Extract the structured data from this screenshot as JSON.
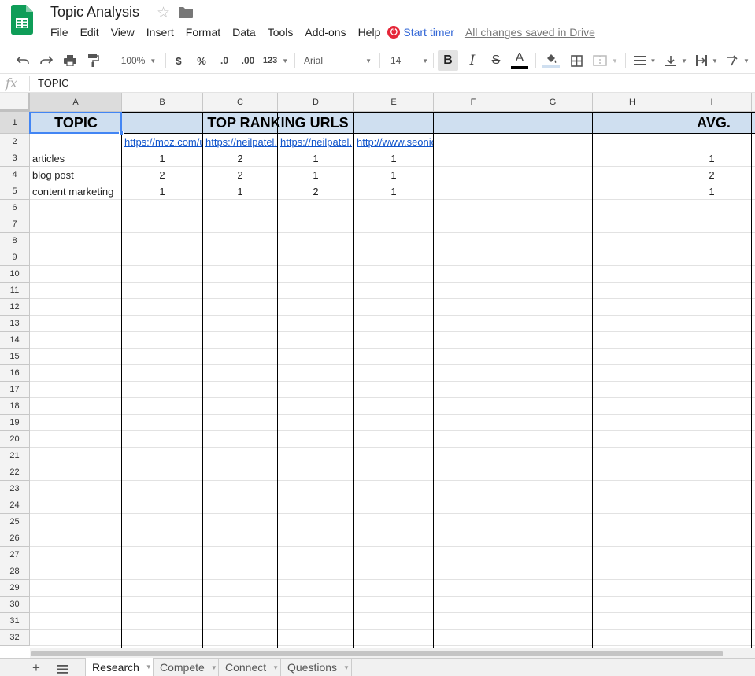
{
  "header": {
    "title": "Topic Analysis",
    "menu": [
      "File",
      "Edit",
      "View",
      "Insert",
      "Format",
      "Data",
      "Tools",
      "Add-ons",
      "Help"
    ],
    "timer_label": "Start timer",
    "save_status": "All changes saved in Drive"
  },
  "toolbar": {
    "zoom": "100%",
    "currency": "$",
    "percent": "%",
    "dec_decrease": ".0",
    "dec_increase": ".00",
    "more_formats": "123",
    "font": "Arial",
    "font_size": "14",
    "bold": "B",
    "italic": "I",
    "strike": "S",
    "text_color": "A"
  },
  "formula_bar": {
    "fx": "fx",
    "value": "TOPIC"
  },
  "columns": [
    "A",
    "B",
    "C",
    "D",
    "E",
    "F",
    "G",
    "H",
    "I"
  ],
  "rows": [
    "1",
    "2",
    "3",
    "4",
    "5",
    "6",
    "7",
    "8",
    "9",
    "10",
    "11",
    "12",
    "13",
    "14",
    "15",
    "16",
    "17",
    "18",
    "19",
    "20",
    "21",
    "22",
    "23",
    "24",
    "25",
    "26",
    "27",
    "28",
    "29",
    "30",
    "31",
    "32"
  ],
  "sheet": {
    "a1": "TOPIC",
    "b1": "TOP RANKING URLS",
    "i1": "AVG.",
    "urls": [
      "https://moz.com/u",
      "https://neilpatel.",
      "https://neilpatel.",
      "http://www.seonic"
    ],
    "data": [
      {
        "topic": "articles",
        "b": "1",
        "c": "2",
        "d": "1",
        "e": "1",
        "avg": "1"
      },
      {
        "topic": "blog post",
        "b": "2",
        "c": "2",
        "d": "1",
        "e": "1",
        "avg": "2"
      },
      {
        "topic": "content marketing",
        "b": "1",
        "c": "1",
        "d": "2",
        "e": "1",
        "avg": "1"
      }
    ]
  },
  "tabs": [
    "Research",
    "Compete",
    "Connect",
    "Questions"
  ],
  "colors": {
    "accent": "#4285f4",
    "header_fill": "#cfdff0",
    "link": "#1155cc",
    "timer": "#e52638"
  }
}
